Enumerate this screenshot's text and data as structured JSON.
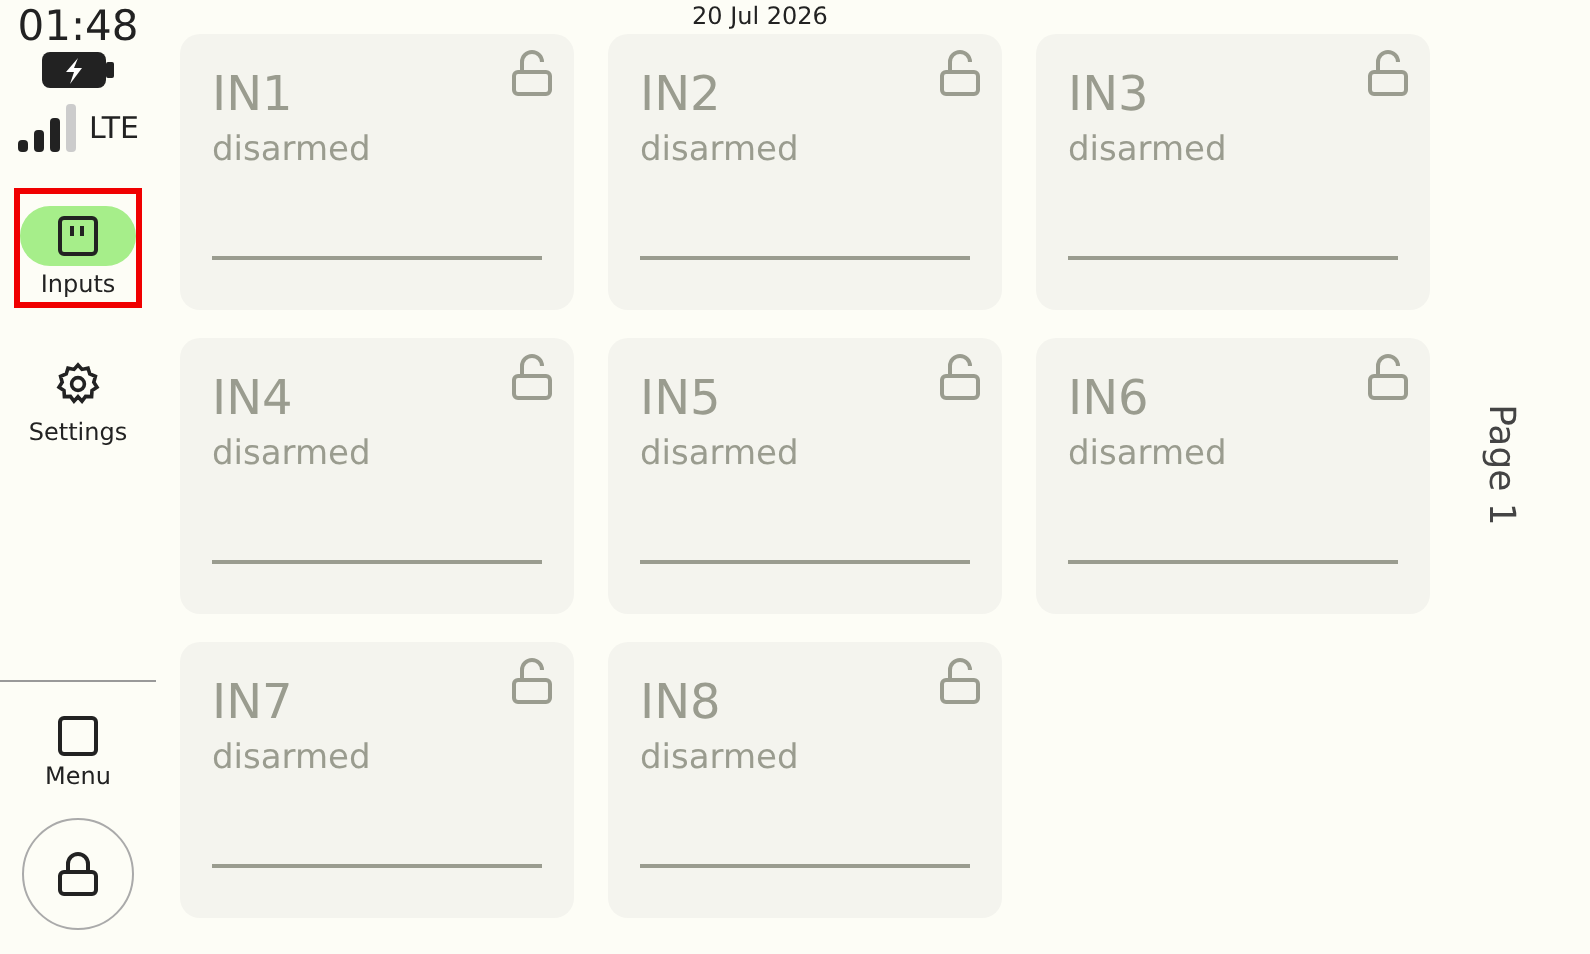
{
  "status": {
    "time": "01:48",
    "network": "LTE",
    "charging": true
  },
  "date": "20 Jul 2026",
  "nav": [
    {
      "label": "Inputs",
      "kind": "inputs",
      "selected": true,
      "highlighted": true
    },
    {
      "label": "Settings",
      "kind": "settings",
      "selected": false,
      "highlighted": false
    }
  ],
  "menu": {
    "label": "Menu"
  },
  "inputs": [
    {
      "name": "IN1",
      "state": "disarmed",
      "locked": false
    },
    {
      "name": "IN2",
      "state": "disarmed",
      "locked": false
    },
    {
      "name": "IN3",
      "state": "disarmed",
      "locked": false
    },
    {
      "name": "IN4",
      "state": "disarmed",
      "locked": false
    },
    {
      "name": "IN5",
      "state": "disarmed",
      "locked": false
    },
    {
      "name": "IN6",
      "state": "disarmed",
      "locked": false
    },
    {
      "name": "IN7",
      "state": "disarmed",
      "locked": false
    },
    {
      "name": "IN8",
      "state": "disarmed",
      "locked": false
    }
  ],
  "page": "Page 1"
}
